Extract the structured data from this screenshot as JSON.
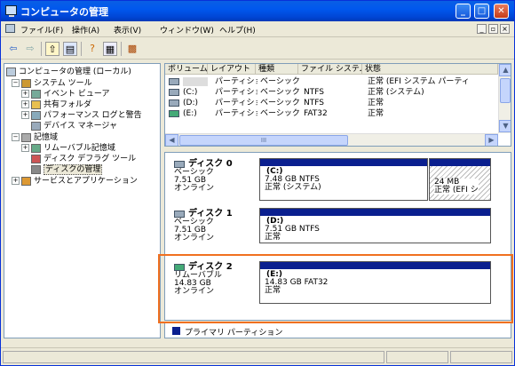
{
  "window": {
    "title": "コンピュータの管理"
  },
  "menu": [
    "ファイル(F)",
    "操作(A)",
    "表示(V)",
    "ウィンドウ(W)",
    "ヘルプ(H)"
  ],
  "tree": [
    {
      "label": "コンピュータの管理 (ローカル)"
    },
    {
      "label": "システム ツール"
    },
    {
      "label": "イベント ビューア"
    },
    {
      "label": "共有フォルダ"
    },
    {
      "label": "パフォーマンス ログと警告"
    },
    {
      "label": "デバイス マネージャ"
    },
    {
      "label": "記憶域"
    },
    {
      "label": "リムーバブル記憶域"
    },
    {
      "label": "ディスク デフラグ ツール"
    },
    {
      "label": "ディスクの管理"
    },
    {
      "label": "サービスとアプリケーション"
    }
  ],
  "table": {
    "headers": [
      "ボリューム",
      "レイアウト",
      "種類",
      "ファイル システム",
      "状態"
    ],
    "rows": [
      [
        "",
        "パーティション",
        "ベーシック",
        "",
        "正常 (EFI システム パーティ"
      ],
      [
        "(C:)",
        "パーティション",
        "ベーシック",
        "NTFS",
        "正常 (システム)"
      ],
      [
        "(D:)",
        "パーティション",
        "ベーシック",
        "NTFS",
        "正常"
      ],
      [
        "(E:)",
        "パーティション",
        "ベーシック",
        "FAT32",
        "正常"
      ]
    ],
    "hscroll_grip": "III"
  },
  "disks": [
    {
      "name": "ディスク 0",
      "type": "ベーシック",
      "size": "7.51 GB",
      "state": "オンライン",
      "partitions": [
        {
          "label": "(C:)",
          "size": "7.48 GB NTFS",
          "status": "正常 (システム)"
        },
        {
          "label": "",
          "size": "24 MB",
          "status": "正常 (EFI シ"
        }
      ]
    },
    {
      "name": "ディスク 1",
      "type": "ベーシック",
      "size": "7.51 GB",
      "state": "オンライン",
      "partitions": [
        {
          "label": "(D:)",
          "size": "7.51 GB NTFS",
          "status": "正常"
        }
      ]
    },
    {
      "name": "ディスク 2",
      "type": "リムーバブル",
      "size": "14.83 GB",
      "state": "オンライン",
      "partitions": [
        {
          "label": "(E:)",
          "size": "14.83 GB FAT32",
          "status": "正常"
        }
      ]
    }
  ],
  "legend": {
    "label": "プライマリ パーティション"
  },
  "colors": {
    "titlebar": "#0058ee",
    "partition_bar": "#0a1f8f",
    "highlight": "#f07020"
  }
}
